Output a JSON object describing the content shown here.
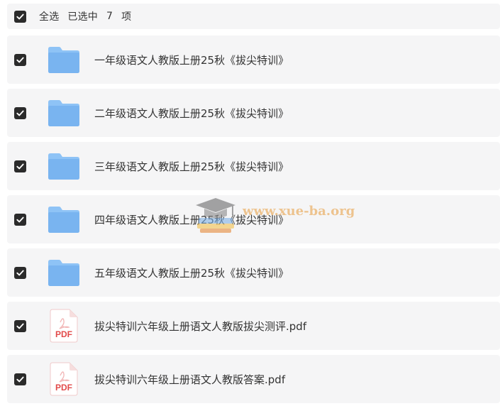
{
  "header": {
    "select_all_label": "全选",
    "selected_label": "已选中",
    "selected_count": "7",
    "count_unit": "项",
    "all_checked": true
  },
  "files": [
    {
      "name": "一年级语文人教版上册25秋《拔尖特训》",
      "type": "folder",
      "icon": "folder-icon",
      "checked": true
    },
    {
      "name": "二年级语文人教版上册25秋《拔尖特训》",
      "type": "folder",
      "icon": "folder-icon",
      "checked": true
    },
    {
      "name": "三年级语文人教版上册25秋《拔尖特训》",
      "type": "folder",
      "icon": "folder-icon",
      "checked": true
    },
    {
      "name": "四年级语文人教版上册25秋《拔尖特训》",
      "type": "folder",
      "icon": "folder-icon",
      "checked": true
    },
    {
      "name": "五年级语文人教版上册25秋《拔尖特训》",
      "type": "folder",
      "icon": "folder-icon",
      "checked": true
    },
    {
      "name": "拔尖特训六年级上册语文人教版拔尖测评.pdf",
      "type": "pdf",
      "icon": "pdf-icon",
      "icon_label": "PDF",
      "checked": true
    },
    {
      "name": "拔尖特训六年级上册语文人教版答案.pdf",
      "type": "pdf",
      "icon": "pdf-icon",
      "icon_label": "PDF",
      "checked": true
    }
  ],
  "watermark": {
    "text": "www.xue-ba.org",
    "icon": "graduation-cap-logo"
  },
  "colors": {
    "row_background": "#f5f5f6",
    "checkbox": "#2b2b2b",
    "folder": "#7fb8f4",
    "pdf_red": "#e24a4a",
    "watermark": "#e9a24a"
  }
}
